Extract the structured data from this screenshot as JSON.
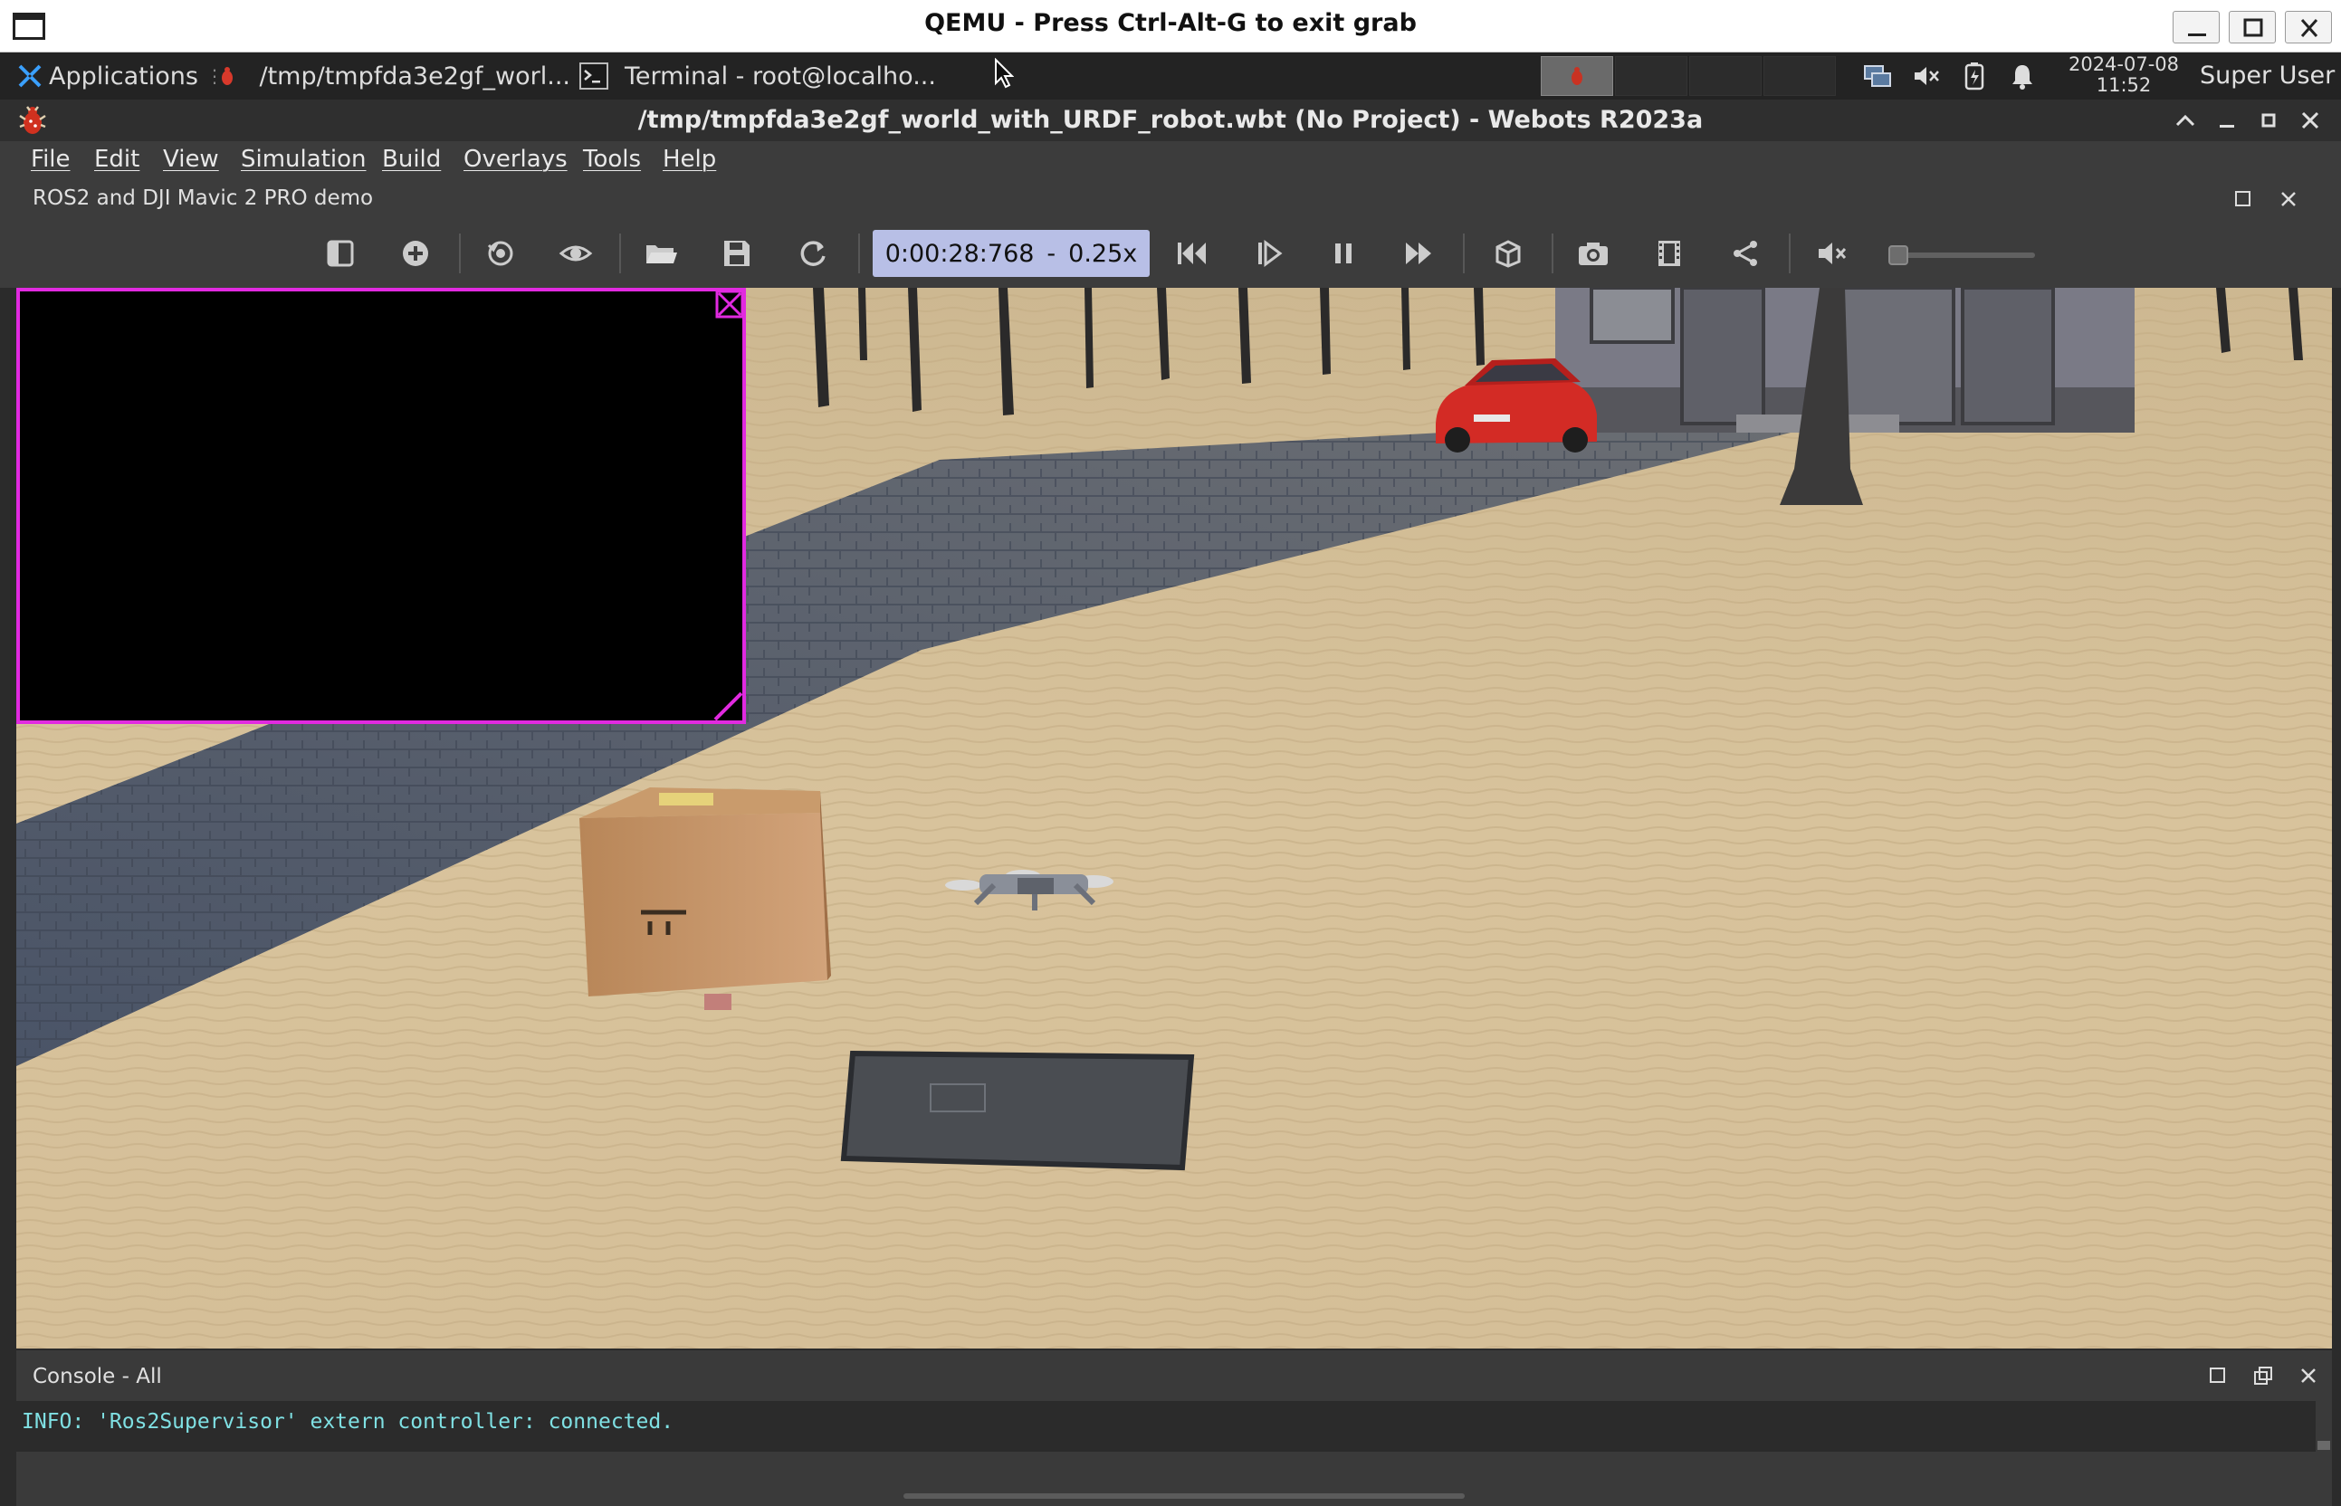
{
  "qemu": {
    "title": "QEMU - Press Ctrl-Alt-G to exit grab"
  },
  "panel": {
    "applications_label": "Applications",
    "task_webots_label": "/tmp/tmpfda3e2gf_worl...",
    "task_terminal_label": "Terminal - root@localho...",
    "clock_date": "2024-07-08",
    "clock_time": "11:52",
    "user": "Super User"
  },
  "webots": {
    "window_title": "/tmp/tmpfda3e2gf_world_with_URDF_robot.wbt (No Project) - Webots R2023a",
    "menu": {
      "file": "File",
      "edit": "Edit",
      "view": "View",
      "simulation": "Simulation",
      "build": "Build",
      "overlays": "Overlays",
      "tools": "Tools",
      "help": "Help"
    },
    "world_info_title": "ROS2 and DJI Mavic 2 PRO demo",
    "simulation_time": "0:00:28:768",
    "time_separator": "-",
    "speed": "0.25x"
  },
  "console": {
    "title": "Console - All",
    "line": "INFO: 'Ros2Supervisor' extern controller: connected."
  },
  "colors": {
    "overlay_border": "#e12ae0",
    "time_display_bg": "#b8bfe6",
    "console_text": "#7fe0e3"
  }
}
